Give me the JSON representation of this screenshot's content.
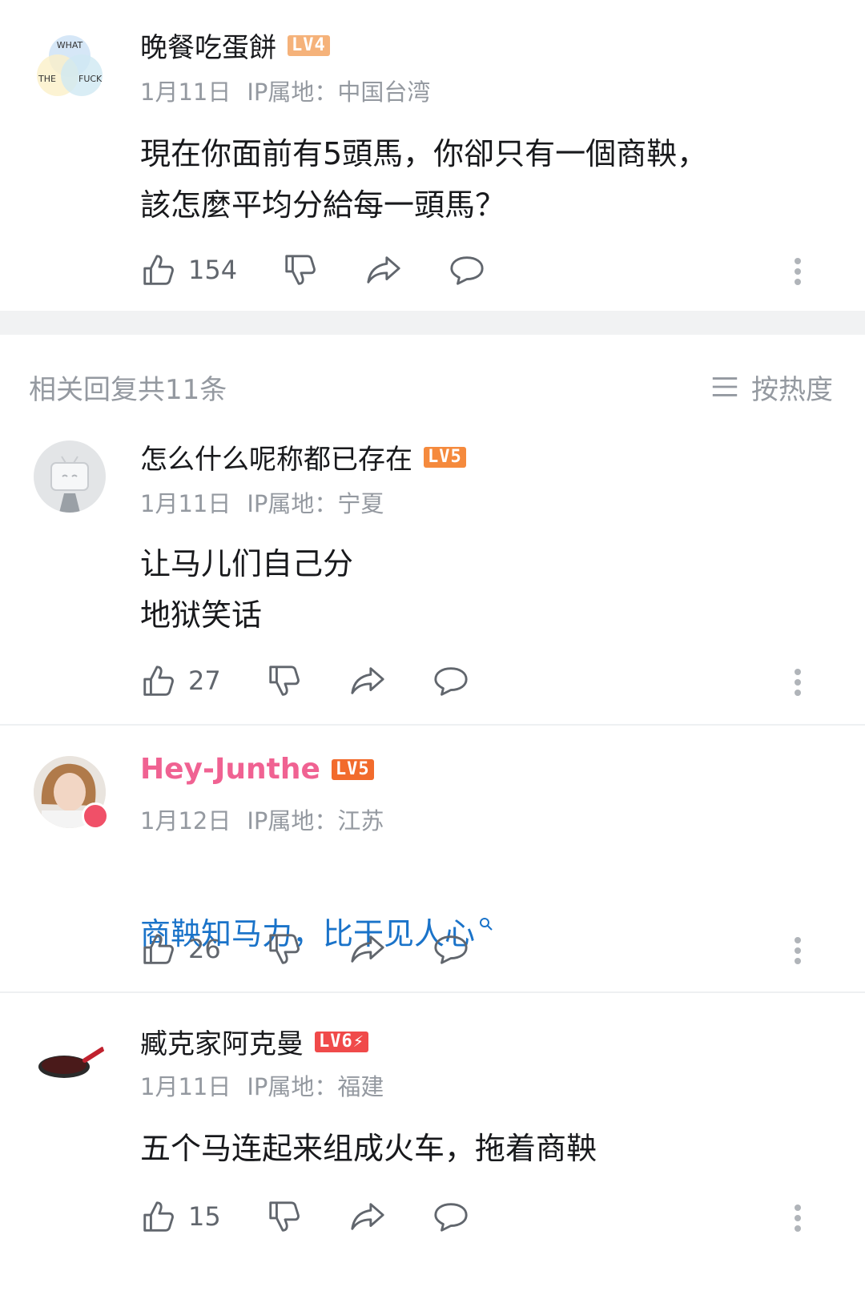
{
  "root": {
    "username": "晚餐吃蛋餅",
    "level": "LV4",
    "level_color": "#f5b27a",
    "date": "1月11日",
    "ip": "IP属地：中国台湾",
    "content": "現在你面前有5頭馬，你卻只有一個商鞅，\n該怎麼平均分給每一頭馬？",
    "likes": "154",
    "avatar_text": {
      "top": "WHAT",
      "left": "THE",
      "right": "FUCK"
    }
  },
  "replies_header": {
    "title": "相关回复共11条",
    "sort_label": "按热度"
  },
  "replies": [
    {
      "username": "怎么什么呢称都已存在",
      "level": "LV5",
      "level_color": "#f58a3d",
      "date": "1月11日",
      "ip": "IP属地：宁夏",
      "content": "让马儿们自己分\n地狱笑话",
      "likes": "27",
      "link": false
    },
    {
      "username": "Hey-Junthe",
      "level": "LV5",
      "level_color": "#f26b2c",
      "date": "1月12日",
      "ip": "IP属地：江苏",
      "content": "商鞅知马力，比干见人心",
      "likes": "26",
      "link": true
    },
    {
      "username": "臧克家阿克曼",
      "level": "LV6⚡",
      "level_color": "#f04a4a",
      "date": "1月11日",
      "ip": "IP属地：福建",
      "content": "五个马连起来组成火车，拖着商鞅",
      "likes": "15",
      "link": false
    }
  ],
  "icons": [
    "like-icon",
    "dislike-icon",
    "share-icon",
    "reply-icon",
    "more-icon",
    "sort-icon",
    "search-icon"
  ]
}
